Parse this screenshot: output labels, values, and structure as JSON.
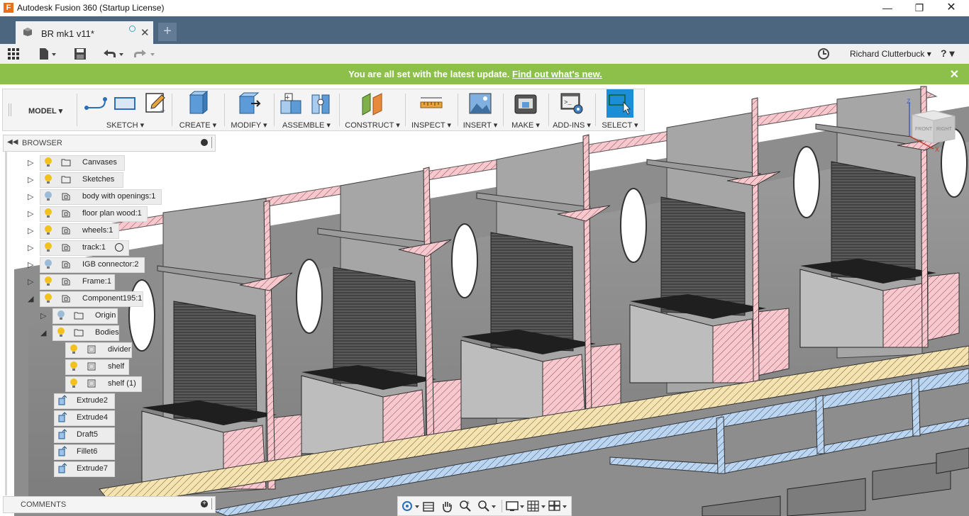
{
  "window": {
    "title": "Autodesk Fusion 360 (Startup License)",
    "app_icon_letter": "F"
  },
  "tabs": {
    "document": "BR mk1 v11*",
    "new_tab": "+",
    "close": "✕"
  },
  "qab": {
    "user": "Richard Clutterbuck ▾",
    "help": "? ▾"
  },
  "banner": {
    "message": "You are all set with the latest update.",
    "link": "Find out what's new.",
    "close": "✕",
    "color": "#8cc04b"
  },
  "toolbar": {
    "workspace": "MODEL ▾",
    "groups": {
      "sketch": "SKETCH ▾",
      "create": "CREATE ▾",
      "modify": "MODIFY ▾",
      "assemble": "ASSEMBLE ▾",
      "construct": "CONSTRUCT ▾",
      "inspect": "INSPECT ▾",
      "insert": "INSERT ▾",
      "make": "MAKE ▾",
      "addins": "ADD-INS ▾",
      "select": "SELECT ▾"
    }
  },
  "browser": {
    "title": "BROWSER",
    "items": [
      {
        "label": "Canvases",
        "icon": "folder-icon"
      },
      {
        "label": "Sketches",
        "icon": "folder-icon"
      },
      {
        "label": "body with openings:1",
        "icon": "component-icon"
      },
      {
        "label": "floor plan wood:1",
        "icon": "component-icon"
      },
      {
        "label": "wheels:1",
        "icon": "component-icon"
      },
      {
        "label": "track:1",
        "icon": "component-icon"
      },
      {
        "label": "IGB connector:2",
        "icon": "component-icon"
      },
      {
        "label": "Frame:1",
        "icon": "component-icon"
      },
      {
        "label": "Component195:1",
        "icon": "component-icon"
      },
      {
        "label": "Origin",
        "icon": "folder-icon"
      },
      {
        "label": "Bodies",
        "icon": "folder-icon"
      },
      {
        "label": "divider",
        "icon": "body-icon"
      },
      {
        "label": "shelf",
        "icon": "body-icon"
      },
      {
        "label": "shelf (1)",
        "icon": "body-icon"
      }
    ],
    "timeline": [
      "Extrude2",
      "Extrude4",
      "Draft5",
      "Fillet6",
      "Extrude7"
    ]
  },
  "comments": {
    "title": "COMMENTS"
  },
  "viewcube": {
    "axis_z": "Z",
    "face_front": "FRONT",
    "face_right": "RIGHT",
    "axis_x": "X"
  }
}
